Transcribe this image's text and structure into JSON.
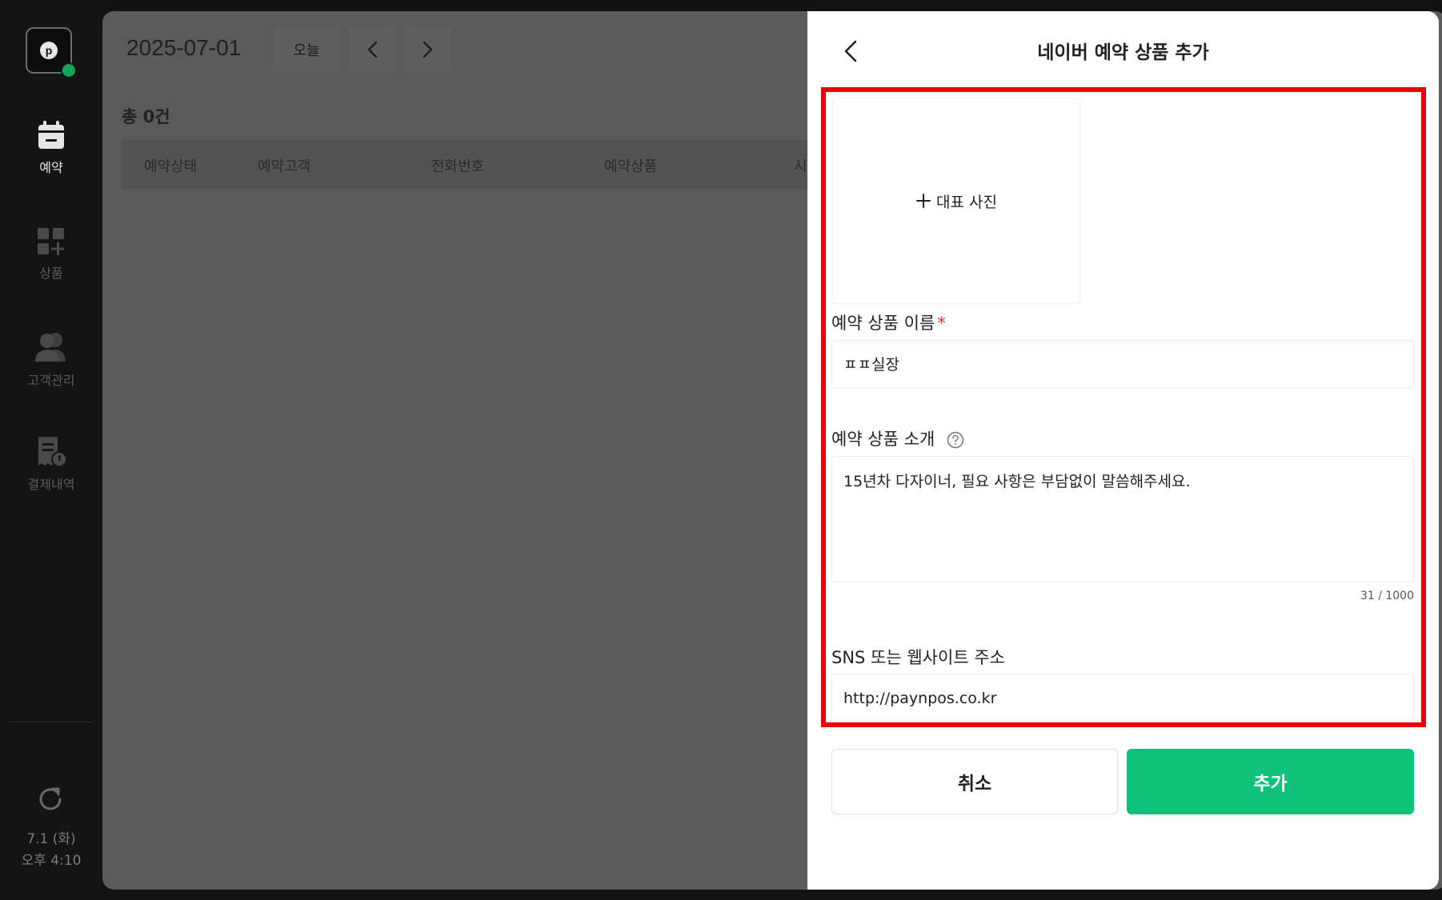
{
  "sidebar": {
    "logo_letter": "p",
    "items": [
      {
        "label": "예약",
        "icon": "calendar-icon",
        "active": true
      },
      {
        "label": "상품",
        "icon": "add-grid-icon",
        "active": false
      },
      {
        "label": "고객관리",
        "icon": "users-icon",
        "active": false
      },
      {
        "label": "결제내역",
        "icon": "receipt-icon",
        "active": false
      }
    ],
    "clock": {
      "date": "7.1 (화)",
      "time": "오후 4:10"
    }
  },
  "main": {
    "date": "2025-07-01",
    "today_label": "오늘",
    "total_label": "총 0건",
    "columns": [
      "예약상태",
      "예약고객",
      "전화번호",
      "예약상품",
      "시"
    ]
  },
  "panel": {
    "title": "네이버 예약 상품 추가",
    "photo_label": "대표 사진",
    "name": {
      "label": "예약 상품 이름",
      "required_mark": "*",
      "value": "ㅍㅍ실장"
    },
    "intro": {
      "label": "예약 상품 소개",
      "value": "15년차 다자이너, 필요 사항은 부담없이 말씀해주세요.",
      "count": "31 / 1000"
    },
    "sns": {
      "label": "SNS 또는 웹사이트 주소",
      "value": "http://paynpos.co.kr"
    },
    "cancel_label": "취소",
    "add_label": "추가"
  },
  "colors": {
    "accent": "#0fc27a",
    "highlight": "#e8000b",
    "status_online": "#1aa35b"
  }
}
